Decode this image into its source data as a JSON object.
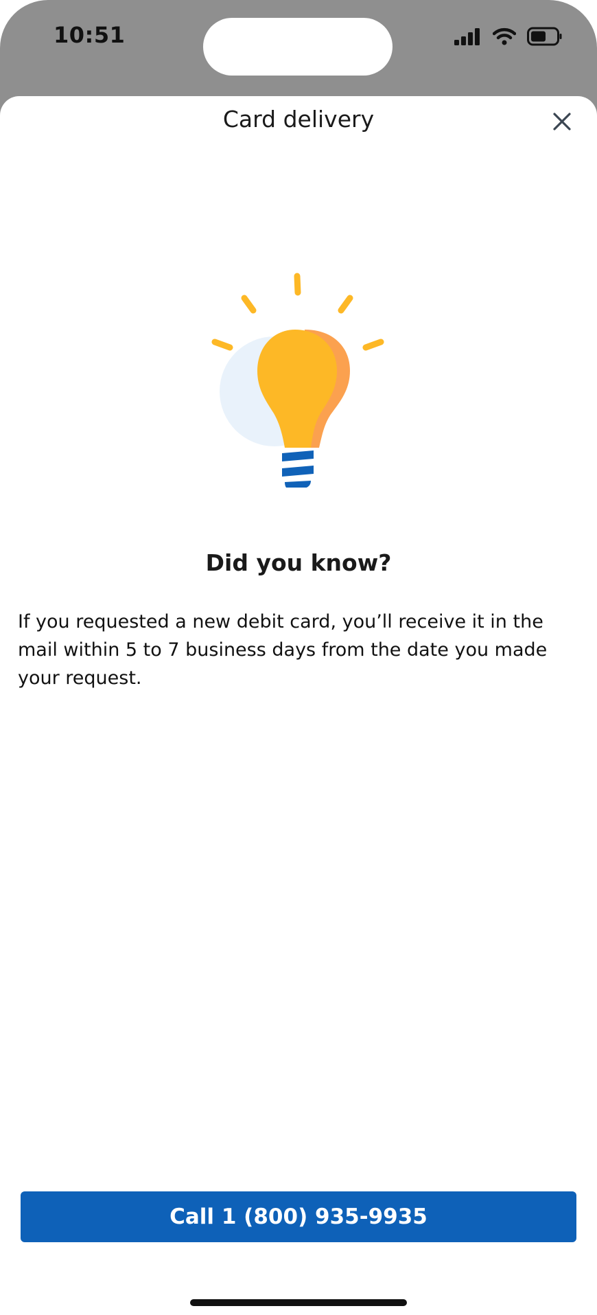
{
  "status_bar": {
    "time": "10:51",
    "icons": [
      "cellular-signal-icon",
      "wifi-icon",
      "battery-icon"
    ]
  },
  "sheet": {
    "title": "Card delivery",
    "close_icon": "close-icon"
  },
  "illustration": {
    "icon": "lightbulb-icon",
    "colors": {
      "bulb": "#fdb826",
      "bulb_shade": "#fba14f",
      "rays": "#fdb826",
      "base_stripes": "#1062b8",
      "backdrop": "#e9f2fb"
    }
  },
  "content": {
    "headline": "Did you know?",
    "body": "If you requested a new debit card, you’ll receive it in the mail within 5 to 7 business days from the date you made your request."
  },
  "actions": {
    "call_label": "Call 1 (800) 935-9935"
  },
  "colors": {
    "primary_button": "#0e61b8",
    "phone_frame": "#8f8f8f"
  }
}
